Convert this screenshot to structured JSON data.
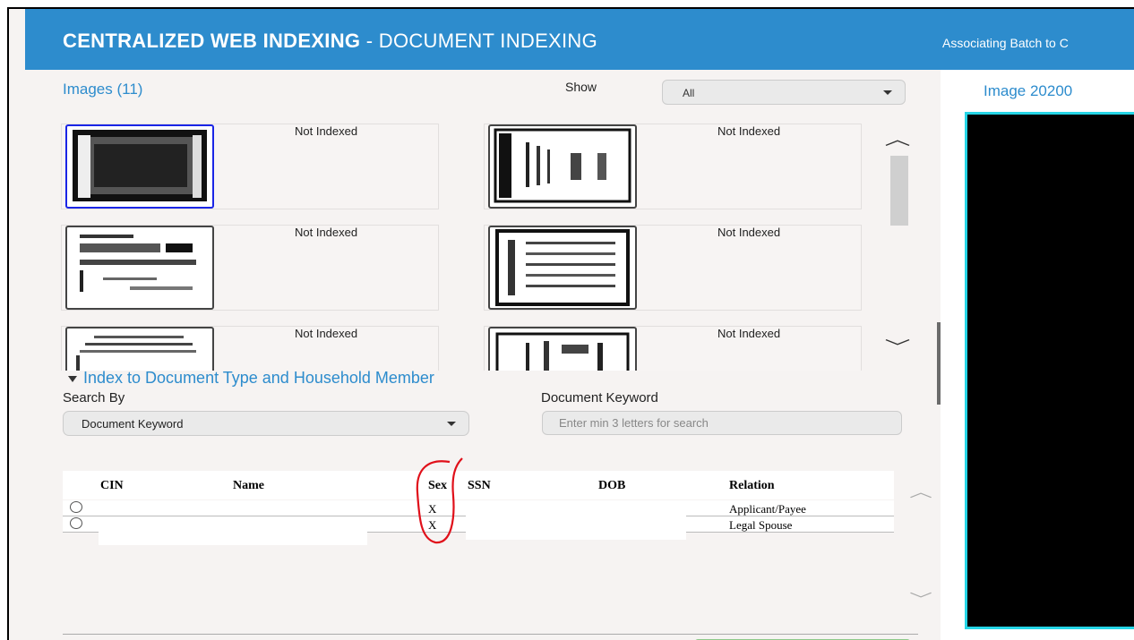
{
  "header": {
    "title_bold": "CENTRALIZED WEB INDEXING",
    "title_light": " - DOCUMENT INDEXING",
    "right_text": "Associating Batch to C"
  },
  "images": {
    "title": "Images (11)",
    "show_label": "Show",
    "show_value": "All",
    "cards": [
      {
        "status": "Not Indexed",
        "selected": true
      },
      {
        "status": "Not Indexed",
        "selected": false
      },
      {
        "status": "Not Indexed",
        "selected": false
      },
      {
        "status": "Not Indexed",
        "selected": false
      },
      {
        "status": "Not Indexed",
        "selected": false
      },
      {
        "status": "Not Indexed",
        "selected": false
      }
    ]
  },
  "index_section": {
    "title": "Index to Document Type and Household Member",
    "search_by_label": "Search By",
    "search_by_value": "Document Keyword",
    "keyword_label": "Document Keyword",
    "keyword_placeholder": "Enter min 3 letters for search"
  },
  "table": {
    "headers": {
      "cin": "CIN",
      "name": "Name",
      "sex": "Sex",
      "ssn": "SSN",
      "dob": "DOB",
      "relation": "Relation"
    },
    "rows": [
      {
        "sex": "X",
        "relation": "Applicant/Payee"
      },
      {
        "sex": "X",
        "relation": "Legal Spouse"
      }
    ]
  },
  "viewer": {
    "title": "Image 20200"
  },
  "colors": {
    "accent": "#2d8ccd",
    "viewer_border": "#25d5e6",
    "selected_thumb": "#1a25e6",
    "annotation": "#e0101a"
  },
  "icons": [
    "chevron-up-icon",
    "chevron-down-icon",
    "caret-down-icon",
    "collapse-panel-icon",
    "radio-icon"
  ]
}
